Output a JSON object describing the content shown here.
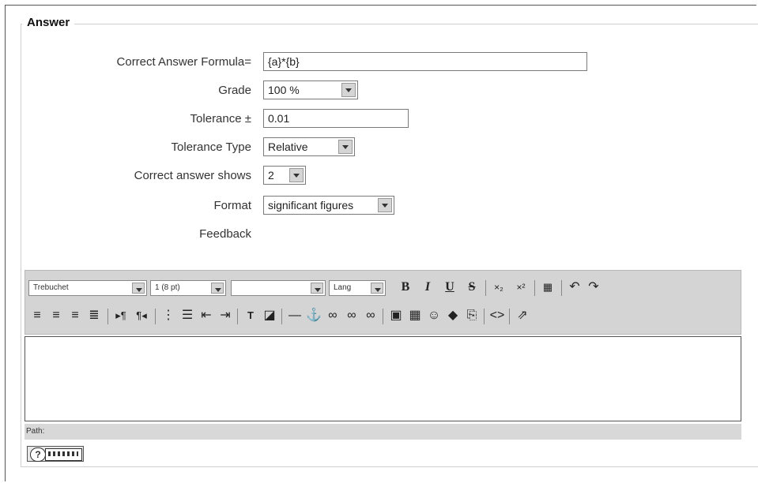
{
  "legend": "Answer",
  "fields": {
    "formula_label": "Correct Answer Formula=",
    "formula_value": "{a}*{b}",
    "grade_label": "Grade",
    "grade_value": "100 %",
    "tolerance_label": "Tolerance ±",
    "tolerance_value": "0.01",
    "tolerance_type_label": "Tolerance Type",
    "tolerance_type_value": "Relative",
    "correct_shows_label": "Correct answer shows",
    "correct_shows_value": "2",
    "format_label": "Format",
    "format_value": "significant figures",
    "feedback_label": "Feedback"
  },
  "editor": {
    "font_select": "Trebuchet",
    "size_select": "1 (8 pt)",
    "style_select": "",
    "lang_select": "Lang",
    "path_label": "Path:"
  },
  "icons": [
    "bold-icon",
    "italic-icon",
    "underline-icon",
    "strikethrough-icon",
    "subscript-icon",
    "superscript-icon",
    "clean-word-icon",
    "undo-icon",
    "redo-icon",
    "align-left-icon",
    "align-center-icon",
    "align-right-icon",
    "justify-icon",
    "ltr-icon",
    "rtl-icon",
    "ordered-list-icon",
    "unordered-list-icon",
    "outdent-icon",
    "indent-icon",
    "text-color-icon",
    "highlight-color-icon",
    "horizontal-rule-icon",
    "anchor-icon",
    "link-icon",
    "unlink-icon",
    "nolink-icon",
    "image-icon",
    "table-icon",
    "smiley-icon",
    "special-char-icon",
    "paste-icon",
    "html-source-icon",
    "fullscreen-icon",
    "help-icon",
    "keyboard-icon"
  ]
}
